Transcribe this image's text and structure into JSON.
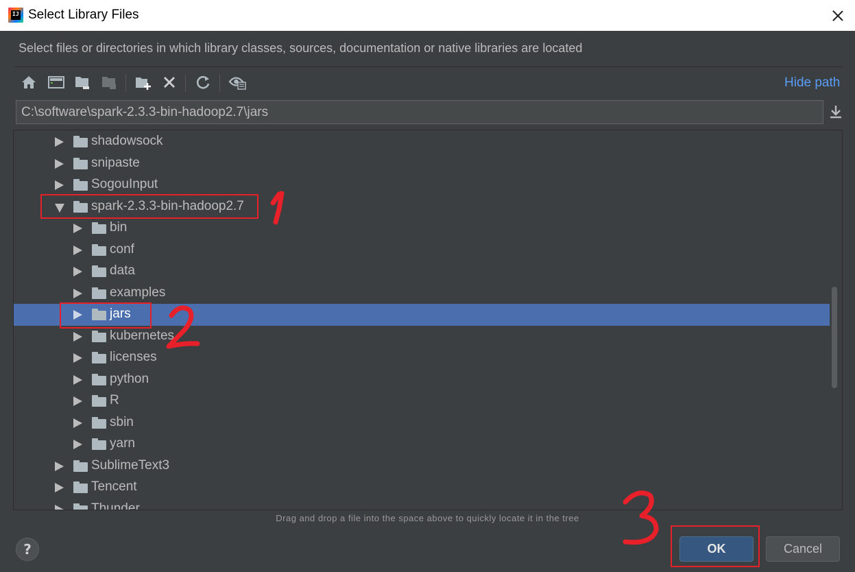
{
  "window": {
    "title": "Select Library Files",
    "app_icon_text": "IJ"
  },
  "description": "Select files or directories in which library classes, sources, documentation or native libraries are located",
  "toolbar": {
    "buttons": [
      "home-icon",
      "desktop-icon",
      "project-folder-icon",
      "module-folder-icon",
      "new-folder-icon",
      "delete-icon",
      "refresh-icon",
      "show-hidden-icon"
    ],
    "hide_path_label": "Hide path"
  },
  "path_field": {
    "value": "C:\\software\\spark-2.3.3-bin-hadoop2.7\\jars"
  },
  "tree": {
    "items": [
      {
        "label": "shadowsock",
        "expanded": false,
        "level": 0
      },
      {
        "label": "snipaste",
        "expanded": false,
        "level": 0
      },
      {
        "label": "SogouInput",
        "expanded": false,
        "level": 0
      },
      {
        "label": "spark-2.3.3-bin-hadoop2.7",
        "expanded": true,
        "level": 0
      },
      {
        "label": "bin",
        "expanded": false,
        "level": 1
      },
      {
        "label": "conf",
        "expanded": false,
        "level": 1
      },
      {
        "label": "data",
        "expanded": false,
        "level": 1
      },
      {
        "label": "examples",
        "expanded": false,
        "level": 1
      },
      {
        "label": "jars",
        "expanded": false,
        "level": 1,
        "selected": true
      },
      {
        "label": "kubernetes",
        "expanded": false,
        "level": 1
      },
      {
        "label": "licenses",
        "expanded": false,
        "level": 1
      },
      {
        "label": "python",
        "expanded": false,
        "level": 1
      },
      {
        "label": "R",
        "expanded": false,
        "level": 1
      },
      {
        "label": "sbin",
        "expanded": false,
        "level": 1
      },
      {
        "label": "yarn",
        "expanded": false,
        "level": 1
      },
      {
        "label": "SublimeText3",
        "expanded": false,
        "level": 0
      },
      {
        "label": "Tencent",
        "expanded": false,
        "level": 0
      },
      {
        "label": "Thunder",
        "expanded": false,
        "level": 0
      }
    ]
  },
  "hint": "Drag and drop a file into the space above to quickly locate it in the tree",
  "footer": {
    "help_label": "?",
    "ok_label": "OK",
    "cancel_label": "Cancel"
  },
  "colors": {
    "background": "#3c3f41",
    "selection": "#4b6eaf",
    "link": "#589df6",
    "annotation": "#e8202a"
  },
  "annotations": [
    "1",
    "2",
    "3"
  ]
}
